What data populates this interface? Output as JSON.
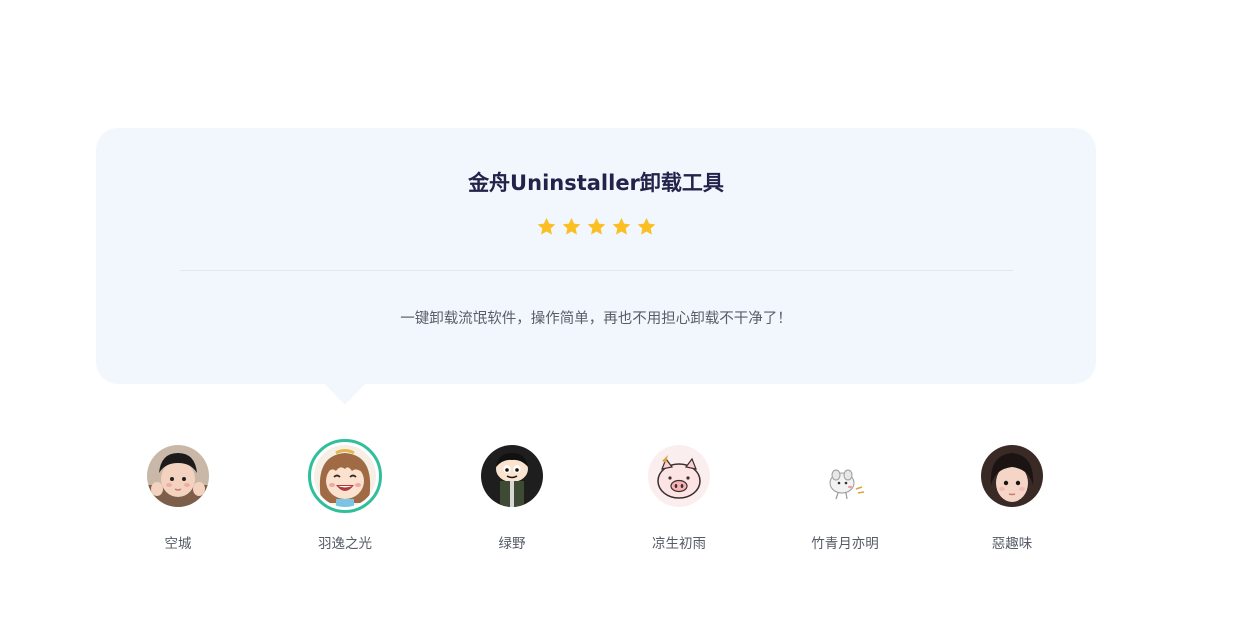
{
  "review": {
    "product_title": "金舟Uninstaller卸载工具",
    "rating": 5,
    "text": "一键卸载流氓软件，操作简单，再也不用担心卸载不干净了！",
    "star_color": "#fbbf24"
  },
  "reviewers": [
    {
      "name": "空城",
      "avatar": "child-photo-avatar",
      "active": false
    },
    {
      "name": "羽逸之光",
      "avatar": "cartoon-girl-avatar",
      "active": true
    },
    {
      "name": "绿野",
      "avatar": "cartoon-boy-avatar",
      "active": false
    },
    {
      "name": "凉生初雨",
      "avatar": "pig-avatar",
      "active": false
    },
    {
      "name": "竹青月亦明",
      "avatar": "hamster-avatar",
      "active": false
    },
    {
      "name": "惡趣味",
      "avatar": "child-photo-avatar",
      "active": false
    }
  ],
  "colors": {
    "card_background": "#f2f7fd",
    "title": "#23224a",
    "active_ring": "#2fbf9a"
  }
}
